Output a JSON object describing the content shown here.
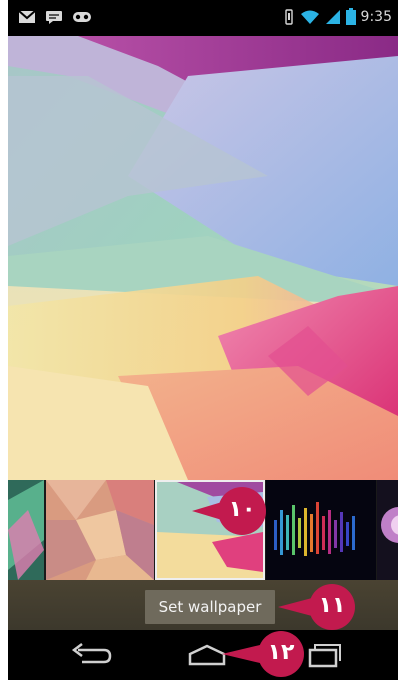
{
  "status_bar": {
    "notification_icons": [
      "gmail-icon",
      "chat-icon",
      "voicemail-icon"
    ],
    "system_icons": [
      "vibrate-icon",
      "wifi-icon",
      "signal-icon",
      "battery-icon"
    ],
    "time": "9:35"
  },
  "wallpaper_picker": {
    "thumbnails": [
      "wallpaper-thumb-1",
      "wallpaper-thumb-2",
      "wallpaper-thumb-3",
      "wallpaper-thumb-4",
      "wallpaper-thumb-5"
    ],
    "selected_index": 2,
    "set_button_label": "Set wallpaper"
  },
  "callouts": {
    "c10": "١٠",
    "c11": "١١",
    "c12": "١٢"
  },
  "nav_bar": {
    "buttons": [
      "back-icon",
      "home-icon",
      "recents-icon"
    ]
  },
  "colors": {
    "callout": "#c21a4e",
    "action_bar": "#403b2f",
    "button": "#6f6a5c"
  }
}
